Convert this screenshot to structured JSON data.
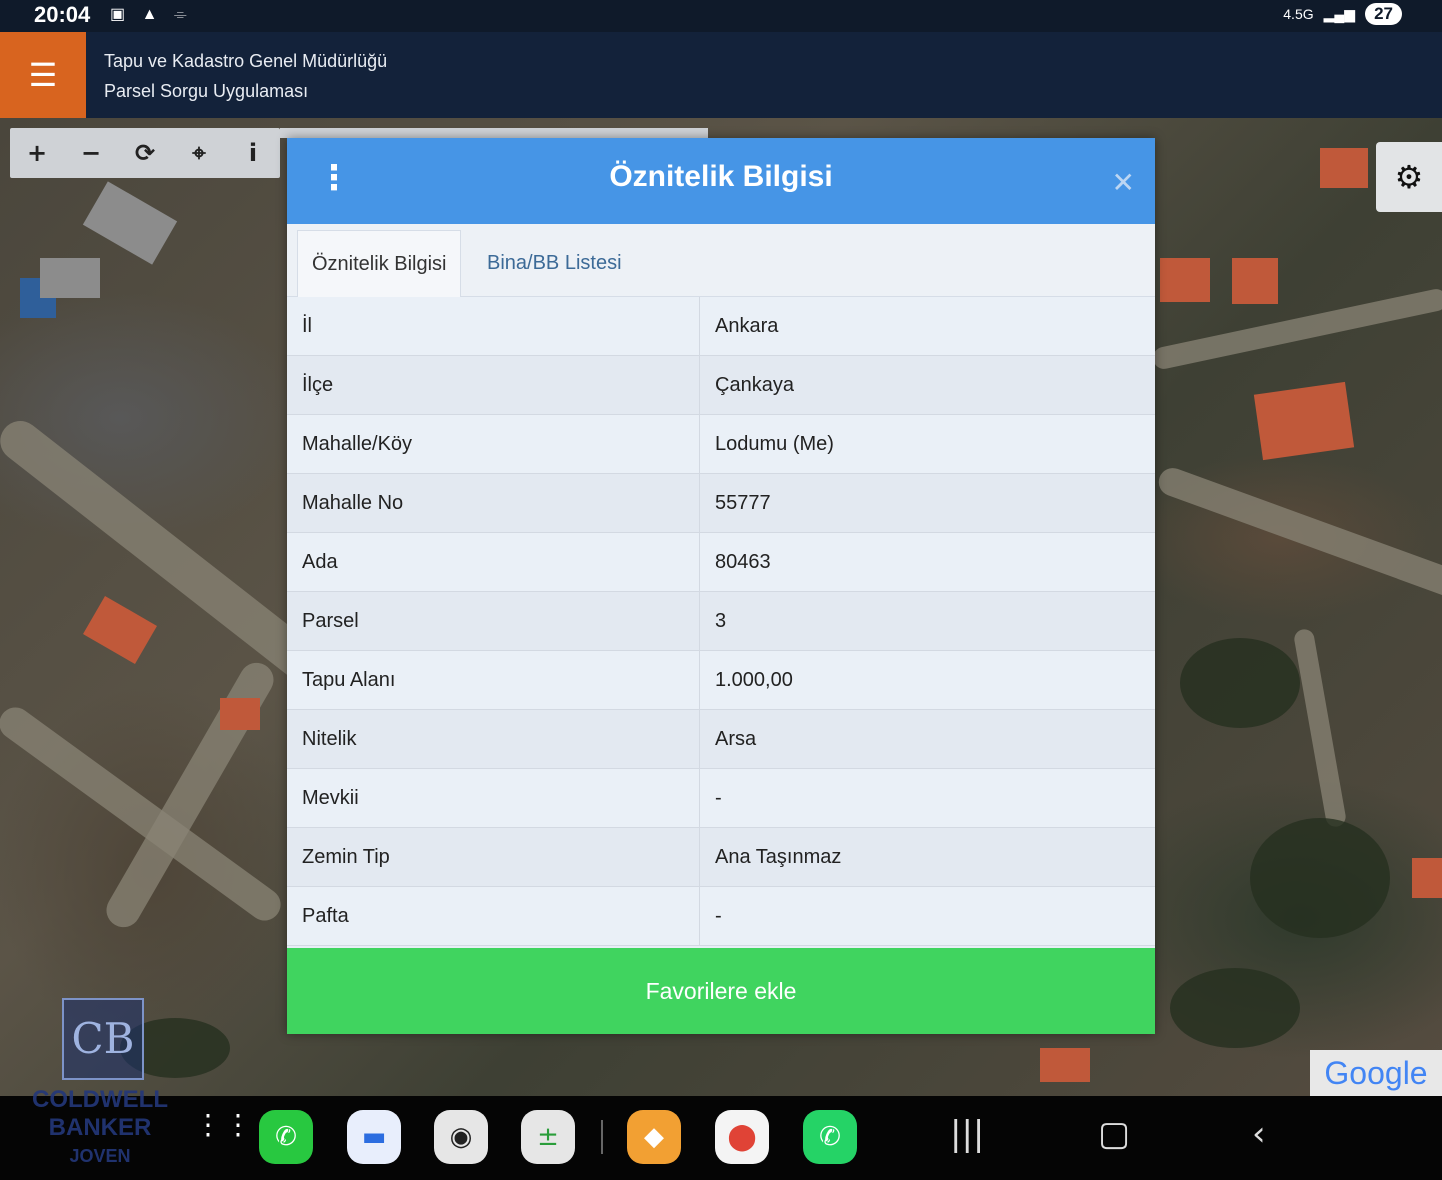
{
  "status_bar": {
    "time": "20:04",
    "network": "4.5G",
    "battery": "27"
  },
  "app": {
    "title_line1": "Tapu ve Kadastro Genel Müdürlüğü",
    "title_line2": "Parsel Sorgu Uygulaması"
  },
  "map_toolbar": {
    "zoom_in": "+",
    "zoom_out": "−",
    "refresh": "⟳",
    "locate": "⌖",
    "info": "i"
  },
  "dialog": {
    "title": "Öznitelik Bilgisi",
    "close": "✕",
    "tabs": [
      "Öznitelik Bilgisi",
      "Bina/BB Listesi"
    ],
    "rows": [
      {
        "key": "İl",
        "value": "Ankara"
      },
      {
        "key": "İlçe",
        "value": "Çankaya"
      },
      {
        "key": "Mahalle/Köy",
        "value": "Lodumu (Me)"
      },
      {
        "key": "Mahalle No",
        "value": "55777"
      },
      {
        "key": "Ada",
        "value": "80463"
      },
      {
        "key": "Parsel",
        "value": "3"
      },
      {
        "key": "Tapu Alanı",
        "value": "1.000,00"
      },
      {
        "key": "Nitelik",
        "value": "Arsa"
      },
      {
        "key": "Mevkii",
        "value": "-"
      },
      {
        "key": "Zemin Tip",
        "value": "Ana Taşınmaz"
      },
      {
        "key": "Pafta",
        "value": "-"
      }
    ],
    "favorite_button": "Favorilere ekle"
  },
  "map_attribution": "Google",
  "watermark": {
    "logo": "CB",
    "line1": "COLDWELL",
    "line2": "BANKER",
    "line3": "JOVEN"
  },
  "colors": {
    "header_bg": "#13223a",
    "menu_accent": "#d8641f",
    "dialog_header": "#4695e6",
    "favorite_button": "#40d45f"
  }
}
